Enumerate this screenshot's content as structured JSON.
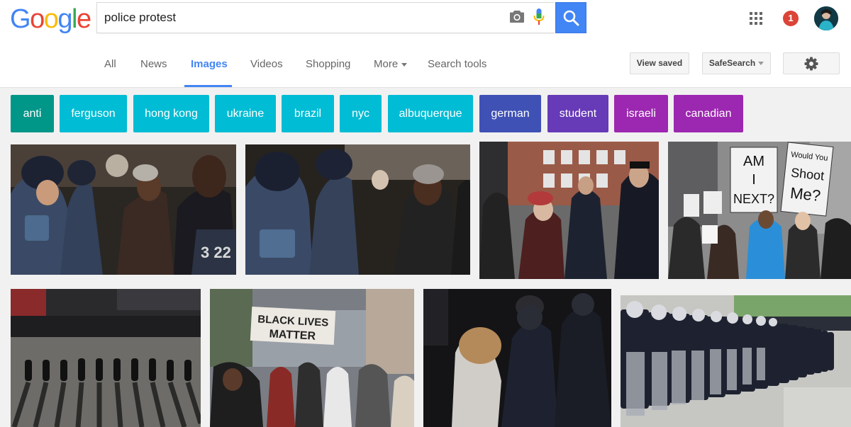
{
  "logo": {
    "letters": [
      "G",
      "o",
      "o",
      "g",
      "l",
      "e"
    ],
    "colors": [
      "#4285f4",
      "#ea4335",
      "#fbbc05",
      "#4285f4",
      "#34a853",
      "#ea4335"
    ]
  },
  "search": {
    "query": "police protest"
  },
  "header": {
    "notification_count": "1"
  },
  "nav": {
    "tabs": [
      {
        "label": "All"
      },
      {
        "label": "News"
      },
      {
        "label": "Images",
        "active": true
      },
      {
        "label": "Videos"
      },
      {
        "label": "Shopping"
      },
      {
        "label": "More"
      },
      {
        "label": "Search tools"
      }
    ],
    "view_saved": "View saved",
    "safesearch": "SafeSearch"
  },
  "chips": [
    {
      "label": "anti",
      "color": "#009688"
    },
    {
      "label": "ferguson",
      "color": "#00bcd4"
    },
    {
      "label": "hong kong",
      "color": "#00bcd4"
    },
    {
      "label": "ukraine",
      "color": "#00bcd4"
    },
    {
      "label": "brazil",
      "color": "#00bcd4"
    },
    {
      "label": "nyc",
      "color": "#00bcd4"
    },
    {
      "label": "albuquerque",
      "color": "#00bcd4"
    },
    {
      "label": "german",
      "color": "#3f51b5"
    },
    {
      "label": "student",
      "color": "#673ab7"
    },
    {
      "label": "israeli",
      "color": "#9c27b0"
    },
    {
      "label": "canadian",
      "color": "#9c27b0"
    }
  ],
  "images": {
    "sign_am_i_next": "AM I NEXT?",
    "sign_would_you_shoot_me": "Would You Shoot Me?",
    "sign_black_lives_matter": "BLACK LIVES MATTER"
  }
}
